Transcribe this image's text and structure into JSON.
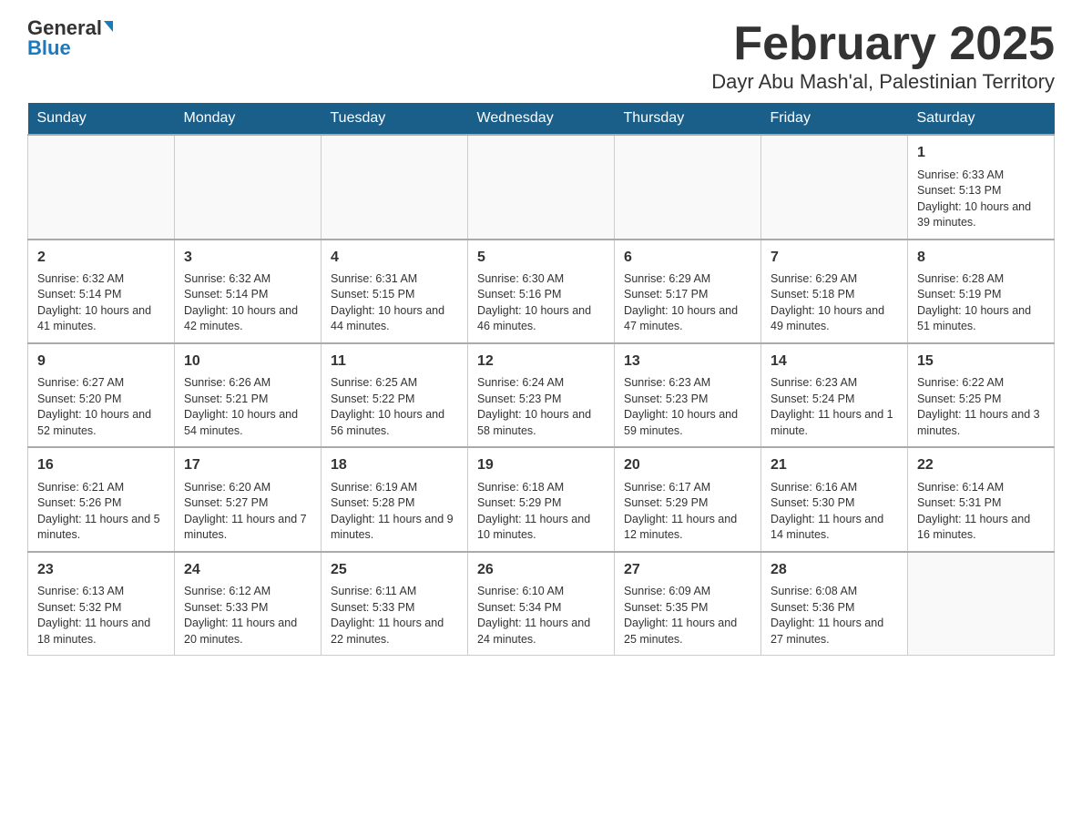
{
  "header": {
    "logo_general": "General",
    "logo_blue": "Blue",
    "title": "February 2025",
    "subtitle": "Dayr Abu Mash'al, Palestinian Territory"
  },
  "calendar": {
    "days_of_week": [
      "Sunday",
      "Monday",
      "Tuesday",
      "Wednesday",
      "Thursday",
      "Friday",
      "Saturday"
    ],
    "weeks": [
      [
        {
          "day": "",
          "info": ""
        },
        {
          "day": "",
          "info": ""
        },
        {
          "day": "",
          "info": ""
        },
        {
          "day": "",
          "info": ""
        },
        {
          "day": "",
          "info": ""
        },
        {
          "day": "",
          "info": ""
        },
        {
          "day": "1",
          "info": "Sunrise: 6:33 AM\nSunset: 5:13 PM\nDaylight: 10 hours and 39 minutes."
        }
      ],
      [
        {
          "day": "2",
          "info": "Sunrise: 6:32 AM\nSunset: 5:14 PM\nDaylight: 10 hours and 41 minutes."
        },
        {
          "day": "3",
          "info": "Sunrise: 6:32 AM\nSunset: 5:14 PM\nDaylight: 10 hours and 42 minutes."
        },
        {
          "day": "4",
          "info": "Sunrise: 6:31 AM\nSunset: 5:15 PM\nDaylight: 10 hours and 44 minutes."
        },
        {
          "day": "5",
          "info": "Sunrise: 6:30 AM\nSunset: 5:16 PM\nDaylight: 10 hours and 46 minutes."
        },
        {
          "day": "6",
          "info": "Sunrise: 6:29 AM\nSunset: 5:17 PM\nDaylight: 10 hours and 47 minutes."
        },
        {
          "day": "7",
          "info": "Sunrise: 6:29 AM\nSunset: 5:18 PM\nDaylight: 10 hours and 49 minutes."
        },
        {
          "day": "8",
          "info": "Sunrise: 6:28 AM\nSunset: 5:19 PM\nDaylight: 10 hours and 51 minutes."
        }
      ],
      [
        {
          "day": "9",
          "info": "Sunrise: 6:27 AM\nSunset: 5:20 PM\nDaylight: 10 hours and 52 minutes."
        },
        {
          "day": "10",
          "info": "Sunrise: 6:26 AM\nSunset: 5:21 PM\nDaylight: 10 hours and 54 minutes."
        },
        {
          "day": "11",
          "info": "Sunrise: 6:25 AM\nSunset: 5:22 PM\nDaylight: 10 hours and 56 minutes."
        },
        {
          "day": "12",
          "info": "Sunrise: 6:24 AM\nSunset: 5:23 PM\nDaylight: 10 hours and 58 minutes."
        },
        {
          "day": "13",
          "info": "Sunrise: 6:23 AM\nSunset: 5:23 PM\nDaylight: 10 hours and 59 minutes."
        },
        {
          "day": "14",
          "info": "Sunrise: 6:23 AM\nSunset: 5:24 PM\nDaylight: 11 hours and 1 minute."
        },
        {
          "day": "15",
          "info": "Sunrise: 6:22 AM\nSunset: 5:25 PM\nDaylight: 11 hours and 3 minutes."
        }
      ],
      [
        {
          "day": "16",
          "info": "Sunrise: 6:21 AM\nSunset: 5:26 PM\nDaylight: 11 hours and 5 minutes."
        },
        {
          "day": "17",
          "info": "Sunrise: 6:20 AM\nSunset: 5:27 PM\nDaylight: 11 hours and 7 minutes."
        },
        {
          "day": "18",
          "info": "Sunrise: 6:19 AM\nSunset: 5:28 PM\nDaylight: 11 hours and 9 minutes."
        },
        {
          "day": "19",
          "info": "Sunrise: 6:18 AM\nSunset: 5:29 PM\nDaylight: 11 hours and 10 minutes."
        },
        {
          "day": "20",
          "info": "Sunrise: 6:17 AM\nSunset: 5:29 PM\nDaylight: 11 hours and 12 minutes."
        },
        {
          "day": "21",
          "info": "Sunrise: 6:16 AM\nSunset: 5:30 PM\nDaylight: 11 hours and 14 minutes."
        },
        {
          "day": "22",
          "info": "Sunrise: 6:14 AM\nSunset: 5:31 PM\nDaylight: 11 hours and 16 minutes."
        }
      ],
      [
        {
          "day": "23",
          "info": "Sunrise: 6:13 AM\nSunset: 5:32 PM\nDaylight: 11 hours and 18 minutes."
        },
        {
          "day": "24",
          "info": "Sunrise: 6:12 AM\nSunset: 5:33 PM\nDaylight: 11 hours and 20 minutes."
        },
        {
          "day": "25",
          "info": "Sunrise: 6:11 AM\nSunset: 5:33 PM\nDaylight: 11 hours and 22 minutes."
        },
        {
          "day": "26",
          "info": "Sunrise: 6:10 AM\nSunset: 5:34 PM\nDaylight: 11 hours and 24 minutes."
        },
        {
          "day": "27",
          "info": "Sunrise: 6:09 AM\nSunset: 5:35 PM\nDaylight: 11 hours and 25 minutes."
        },
        {
          "day": "28",
          "info": "Sunrise: 6:08 AM\nSunset: 5:36 PM\nDaylight: 11 hours and 27 minutes."
        },
        {
          "day": "",
          "info": ""
        }
      ]
    ]
  }
}
